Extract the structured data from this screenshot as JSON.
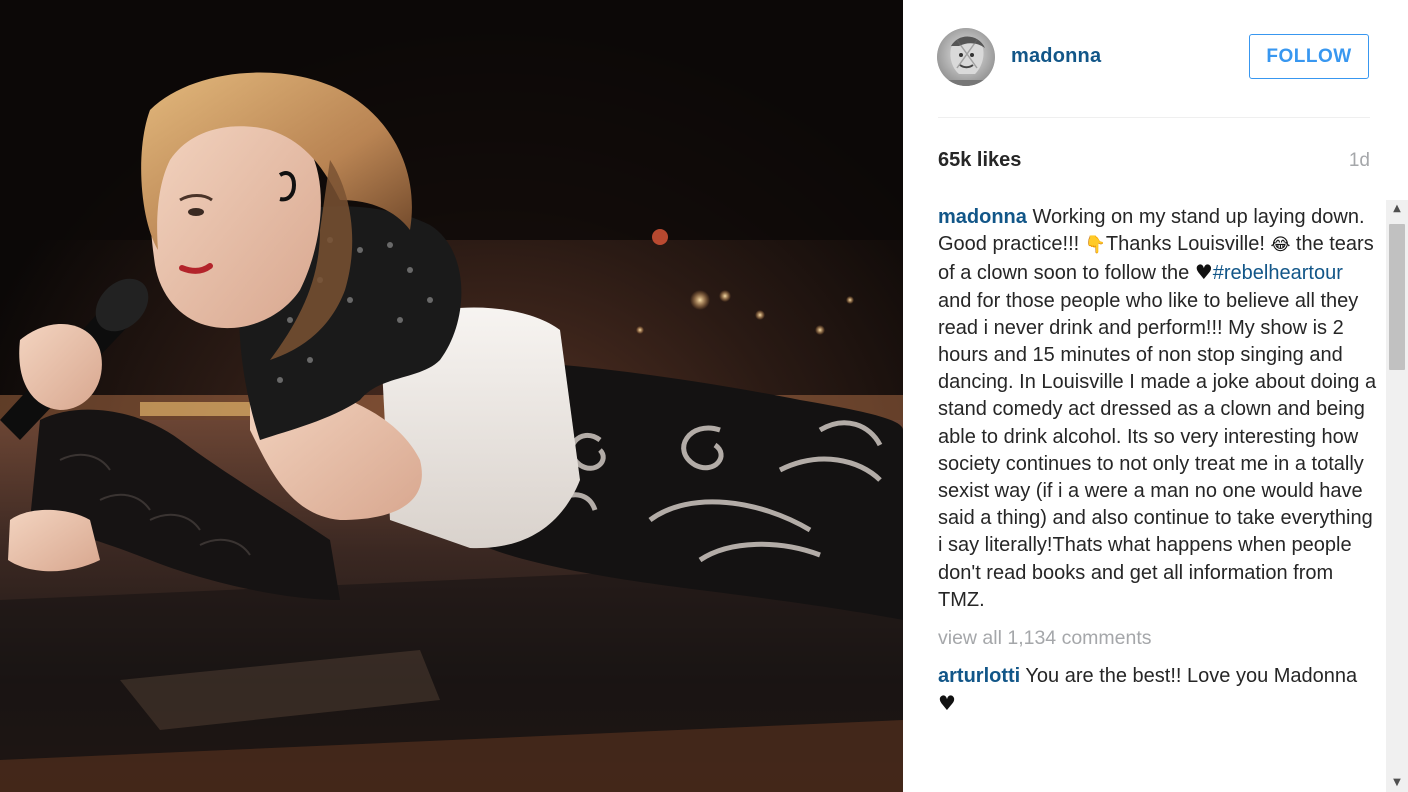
{
  "post": {
    "username": "madonna",
    "follow_label": "FOLLOW",
    "likes": "65k likes",
    "time_ago": "1d"
  },
  "caption": {
    "username": "madonna",
    "text_1": "Working on my stand up laying down. Good practice!!! ",
    "emoji_1": "👇",
    "text_2": "Thanks Louisville! ",
    "emoji_2": "😂",
    "text_3": " the tears of a clown soon to follow the ",
    "heart": "♥",
    "hashtag": "#rebelheartour",
    "text_4": " and for those people who like to believe all they read i never drink and perform!!! My show is 2 hours and 15 minutes of non stop singing and dancing. In Louisville I made a joke about doing a stand comedy act dressed as a clown and being able to drink alcohol. Its so very interesting how society continues to not only treat me in a totally sexist way (if i a were a man no one would have said a thing) and also continue to take everything i say literally!Thats what happens when people don't read books and get all information from TMZ."
  },
  "view_all_comments": "view all 1,134 comments",
  "comments": [
    {
      "username": "arturlotti",
      "text": "You are the best!! Love you Madonna ",
      "heart": "♥"
    }
  ],
  "icons": {
    "scroll_up": "scroll-up-arrow-icon",
    "scroll_down": "scroll-down-arrow-icon",
    "heart": "heart-icon"
  },
  "colors": {
    "username": "#125688",
    "follow": "#3897f0",
    "muted": "#a5a7aa",
    "text": "#262626"
  }
}
